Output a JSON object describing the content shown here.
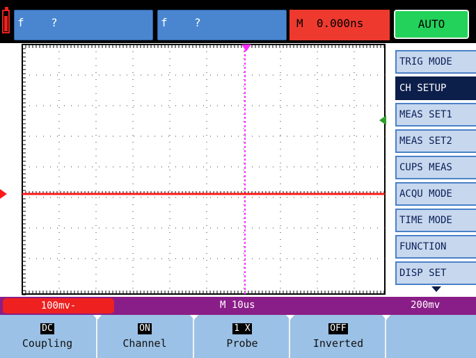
{
  "top_bar": {
    "ch1_freq": {
      "label": "f",
      "value": "?"
    },
    "ch2_freq": {
      "label": "f",
      "value": "?"
    },
    "time_offset": "M  0.000ns",
    "trigger_mode": "AUTO"
  },
  "colors": {
    "ch1": "#ff1a1a",
    "ch2": "#2ca02c",
    "time_marker": "#ff2aff",
    "menu_active": "#0c1e4a",
    "status_bar": "#8a1e88",
    "softkey_bg": "#9bc1e6"
  },
  "menu": {
    "items": [
      {
        "label": "TRIG MODE",
        "active": false
      },
      {
        "label": "CH SETUP",
        "active": true
      },
      {
        "label": "MEAS SET1",
        "active": false
      },
      {
        "label": "MEAS SET2",
        "active": false
      },
      {
        "label": "CUPS MEAS",
        "active": false
      },
      {
        "label": "ACQU MODE",
        "active": false
      },
      {
        "label": "TIME MODE",
        "active": false
      },
      {
        "label": "FUNCTION",
        "active": false
      },
      {
        "label": "DISP SET",
        "active": false
      }
    ],
    "more_icon": "triangle-down-icon"
  },
  "status_bar": {
    "ch1_scale": "100mv-",
    "timebase": "M 10us",
    "ch2_scale": "200mv"
  },
  "softkeys": [
    {
      "value": "DC",
      "label": "Coupling"
    },
    {
      "value": "ON",
      "label": "Channel"
    },
    {
      "value": "1 X",
      "label": "Probe"
    },
    {
      "value": "OFF",
      "label": "Inverted"
    }
  ]
}
